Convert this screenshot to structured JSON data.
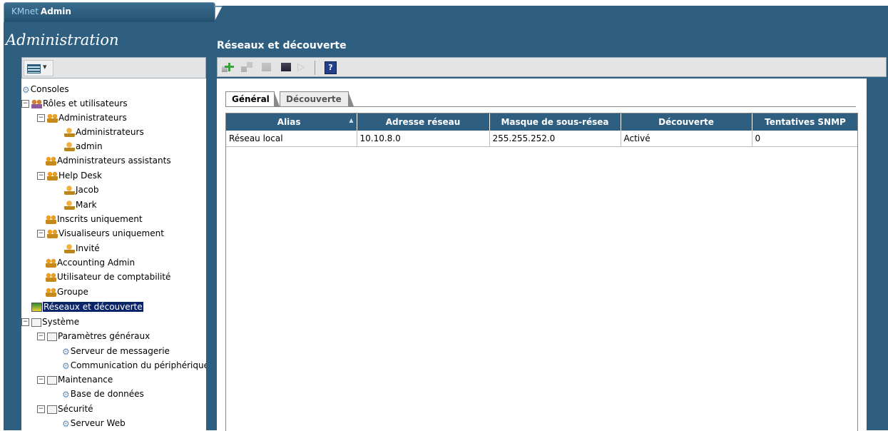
{
  "app": {
    "logo_prefix": "KMnet",
    "logo_suffix": "Admin"
  },
  "left": {
    "title": "Administration",
    "tree": [
      {
        "label": "Consoles",
        "icon": "gear-icon"
      },
      {
        "label": "Rôles et utilisateurs",
        "icon": "roles-icon"
      },
      {
        "label": "Administrateurs",
        "icon": "group-icon"
      },
      {
        "label": "Administrateurs",
        "icon": "user-icon"
      },
      {
        "label": "admin",
        "icon": "user-icon"
      },
      {
        "label": "Administrateurs assistants",
        "icon": "group-icon"
      },
      {
        "label": "Help Desk",
        "icon": "group-icon"
      },
      {
        "label": "Jacob",
        "icon": "user-icon"
      },
      {
        "label": "Mark",
        "icon": "user-icon"
      },
      {
        "label": "Inscrits uniquement",
        "icon": "group-icon"
      },
      {
        "label": "Visualiseurs uniquement",
        "icon": "group-icon"
      },
      {
        "label": "Invité",
        "icon": "user-icon"
      },
      {
        "label": "Accounting Admin",
        "icon": "group-icon"
      },
      {
        "label": "Utilisateur de comptabilité",
        "icon": "group-icon"
      },
      {
        "label": "Groupe",
        "icon": "group-icon"
      },
      {
        "label": "Réseaux et découverte",
        "icon": "network-icon"
      },
      {
        "label": "Système",
        "icon": "folder-icon"
      },
      {
        "label": "Paramètres généraux",
        "icon": "folder-icon"
      },
      {
        "label": "Serveur de messagerie",
        "icon": "gear-icon"
      },
      {
        "label": "Communication du périphérique",
        "icon": "gear-icon"
      },
      {
        "label": "Maintenance",
        "icon": "folder-icon"
      },
      {
        "label": "Base de données",
        "icon": "gear-icon"
      },
      {
        "label": "Sécurité",
        "icon": "folder-icon"
      },
      {
        "label": "Serveur Web",
        "icon": "gear-icon"
      }
    ]
  },
  "right": {
    "title": "Réseaux et découverte",
    "tabs": {
      "general": "Général",
      "discovery": "Découverte"
    },
    "help_label": "?",
    "columns": [
      "Alias",
      "Adresse réseau",
      "Masque de sous-résea",
      "Découverte",
      "Tentatives SNMP"
    ],
    "rows": [
      [
        "Réseau local",
        "10.10.8.0",
        "255.255.252.0",
        "Activé",
        "0"
      ]
    ]
  },
  "colors": {
    "header_blue": "#2f5f80",
    "selection": "#0a246a"
  }
}
